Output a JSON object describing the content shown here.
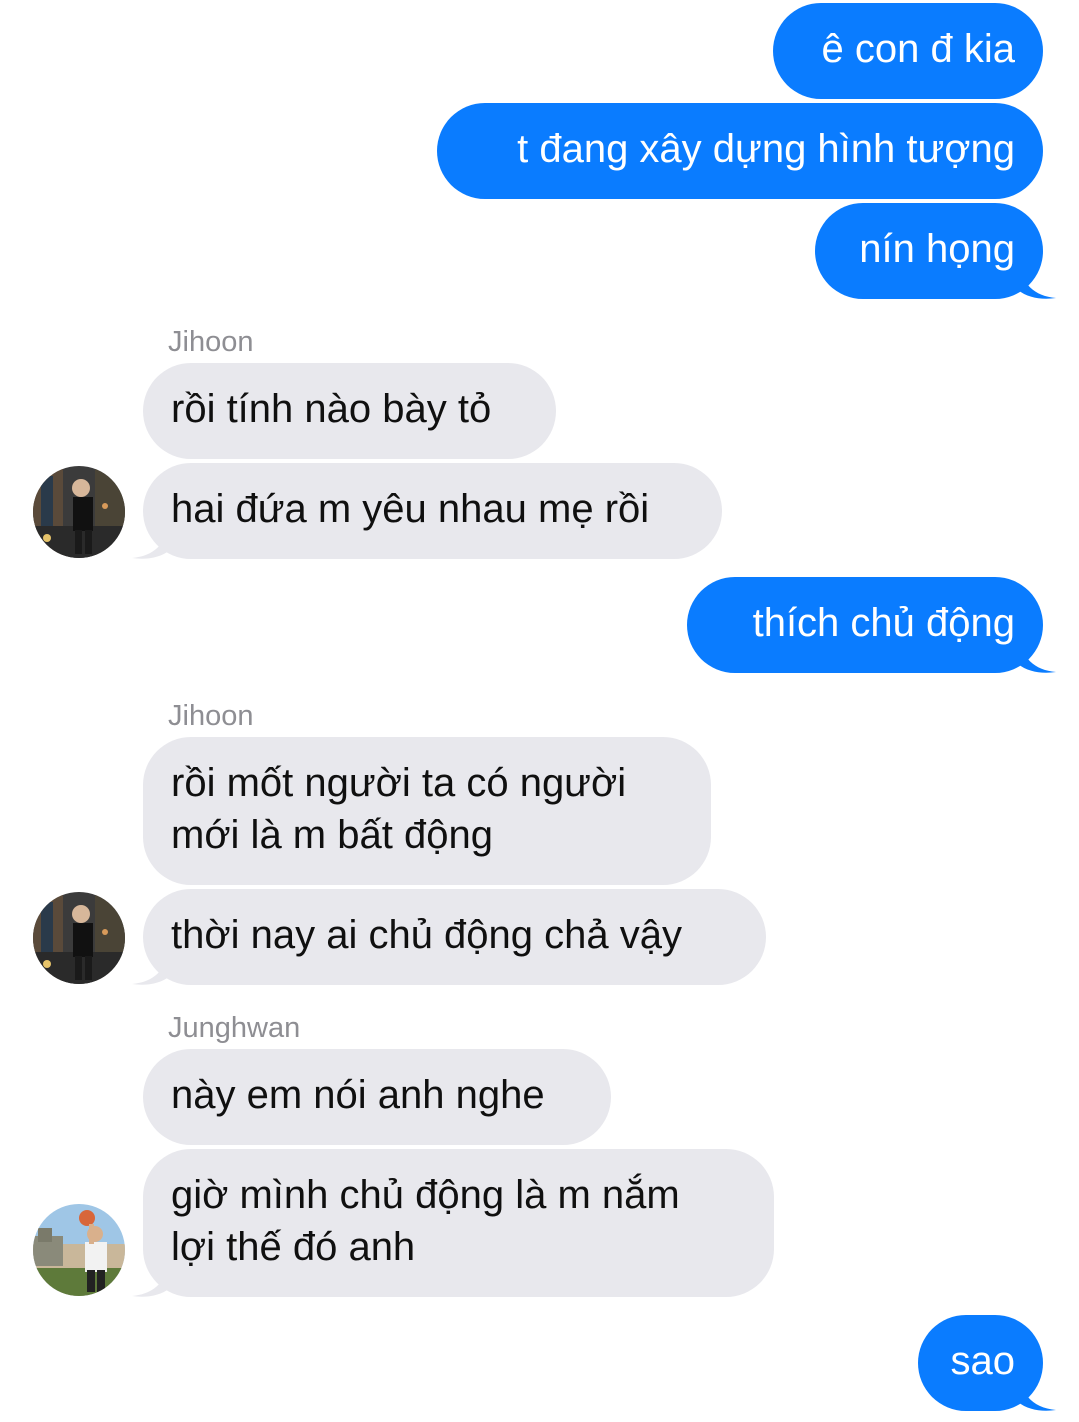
{
  "conversation": {
    "messages": [
      {
        "id": "m1",
        "direction": "outgoing",
        "text": "ê con đ kia"
      },
      {
        "id": "m2",
        "direction": "outgoing",
        "text": "t đang xây dựng hình tượng"
      },
      {
        "id": "m3",
        "direction": "outgoing",
        "text": "nín họng"
      },
      {
        "id": "m4",
        "direction": "incoming",
        "sender": "Jihoon",
        "text": "rồi tính nào bày tỏ"
      },
      {
        "id": "m5",
        "direction": "incoming",
        "sender": "Jihoon",
        "text": "hai đứa m yêu nhau mẹ rồi"
      },
      {
        "id": "m6",
        "direction": "outgoing",
        "text": "thích chủ động"
      },
      {
        "id": "m7",
        "direction": "incoming",
        "sender": "Jihoon",
        "line1": "rồi mốt người ta có người",
        "line2": "mới là m bất động"
      },
      {
        "id": "m8",
        "direction": "incoming",
        "sender": "Jihoon",
        "text": "thời nay ai chủ động chả vậy"
      },
      {
        "id": "m9",
        "direction": "incoming",
        "sender": "Junghwan",
        "text": "này em nói anh nghe"
      },
      {
        "id": "m10",
        "direction": "incoming",
        "sender": "Junghwan",
        "line1": "giờ mình chủ động là m nắm",
        "line2": "lợi thế đó anh"
      },
      {
        "id": "m11",
        "direction": "outgoing",
        "text": "sao"
      }
    ],
    "sender_labels": [
      "Jihoon",
      "Jihoon",
      "Junghwan"
    ]
  },
  "colors": {
    "outgoing_bubble": "#0a7cff",
    "incoming_bubble": "#e8e8ed",
    "sender_label": "#8e8e93"
  }
}
